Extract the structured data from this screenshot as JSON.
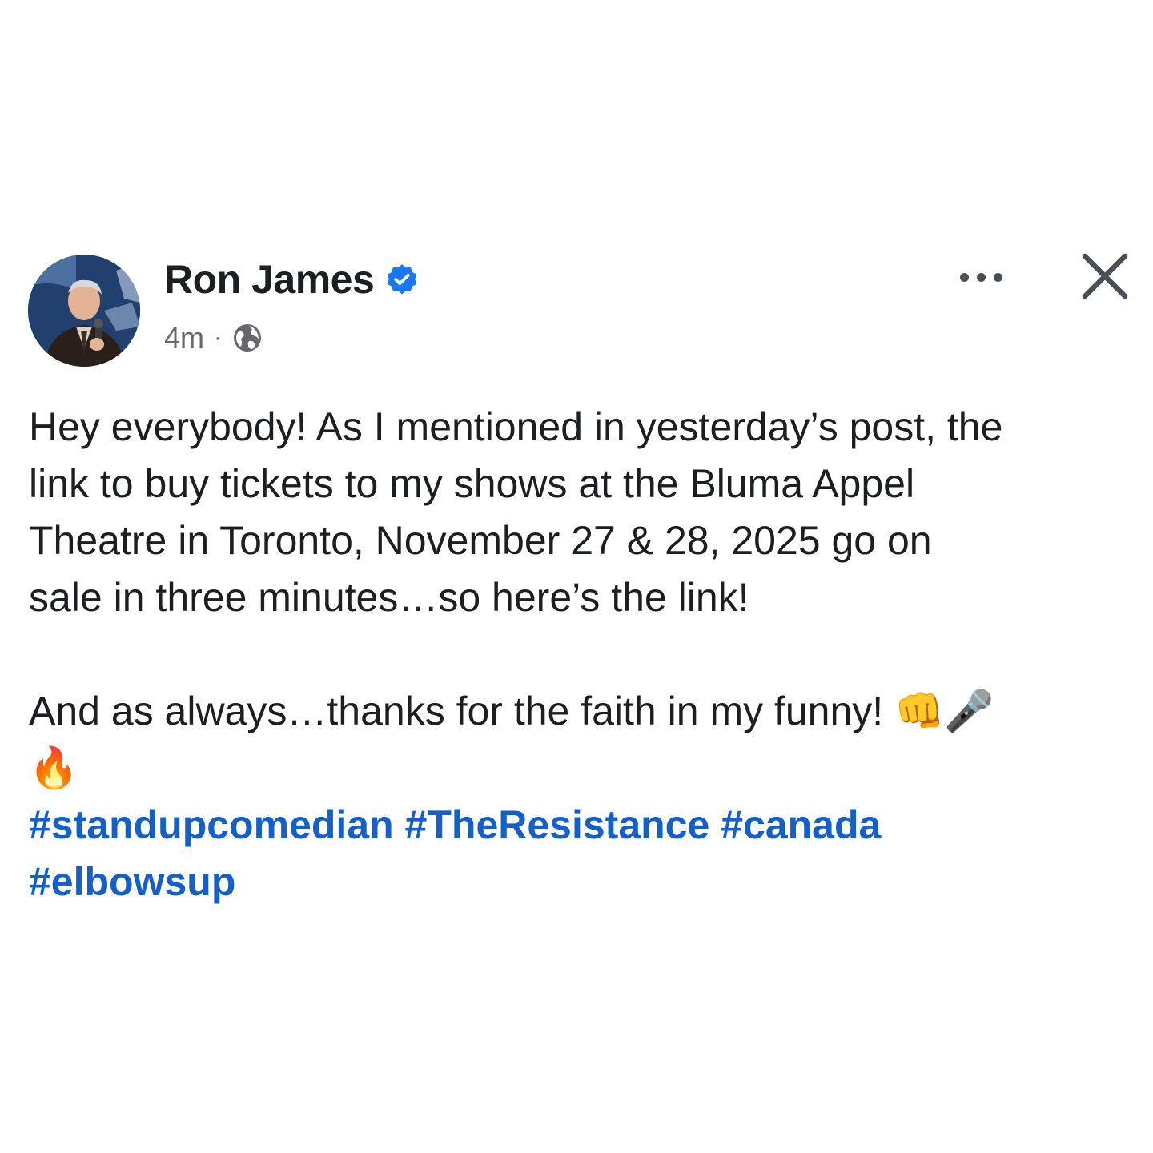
{
  "post": {
    "author": {
      "name": "Ron James",
      "verified_icon": "verified-badge-icon",
      "avatar": "profile-photo"
    },
    "meta": {
      "time": "4m",
      "separator": "·",
      "audience_icon": "globe-icon"
    },
    "actions": {
      "more_icon": "more-options-icon",
      "close_icon": "close-icon"
    },
    "body": {
      "line1": "Hey everybody! As I mentioned in yesterday’s post, the",
      "line2": "link to buy tickets to my shows at the Bluma Appel",
      "line3": "Theatre in Toronto, November 27 & 28, 2025 go on",
      "line4": "sale in three minutes…so here’s the link!",
      "line5": "And as always…thanks for the faith in my funny!",
      "emoji_fist": "👊",
      "emoji_mic": "🎤",
      "emoji_fire": "🔥"
    },
    "hashtags": [
      "#standupcomedian",
      "#TheResistance",
      "#canada",
      "#elbowsup"
    ],
    "colors": {
      "hashtag": "#1460c8",
      "verified": "#1877f2",
      "meta": "#65676b",
      "text": "#1c1e21"
    }
  }
}
